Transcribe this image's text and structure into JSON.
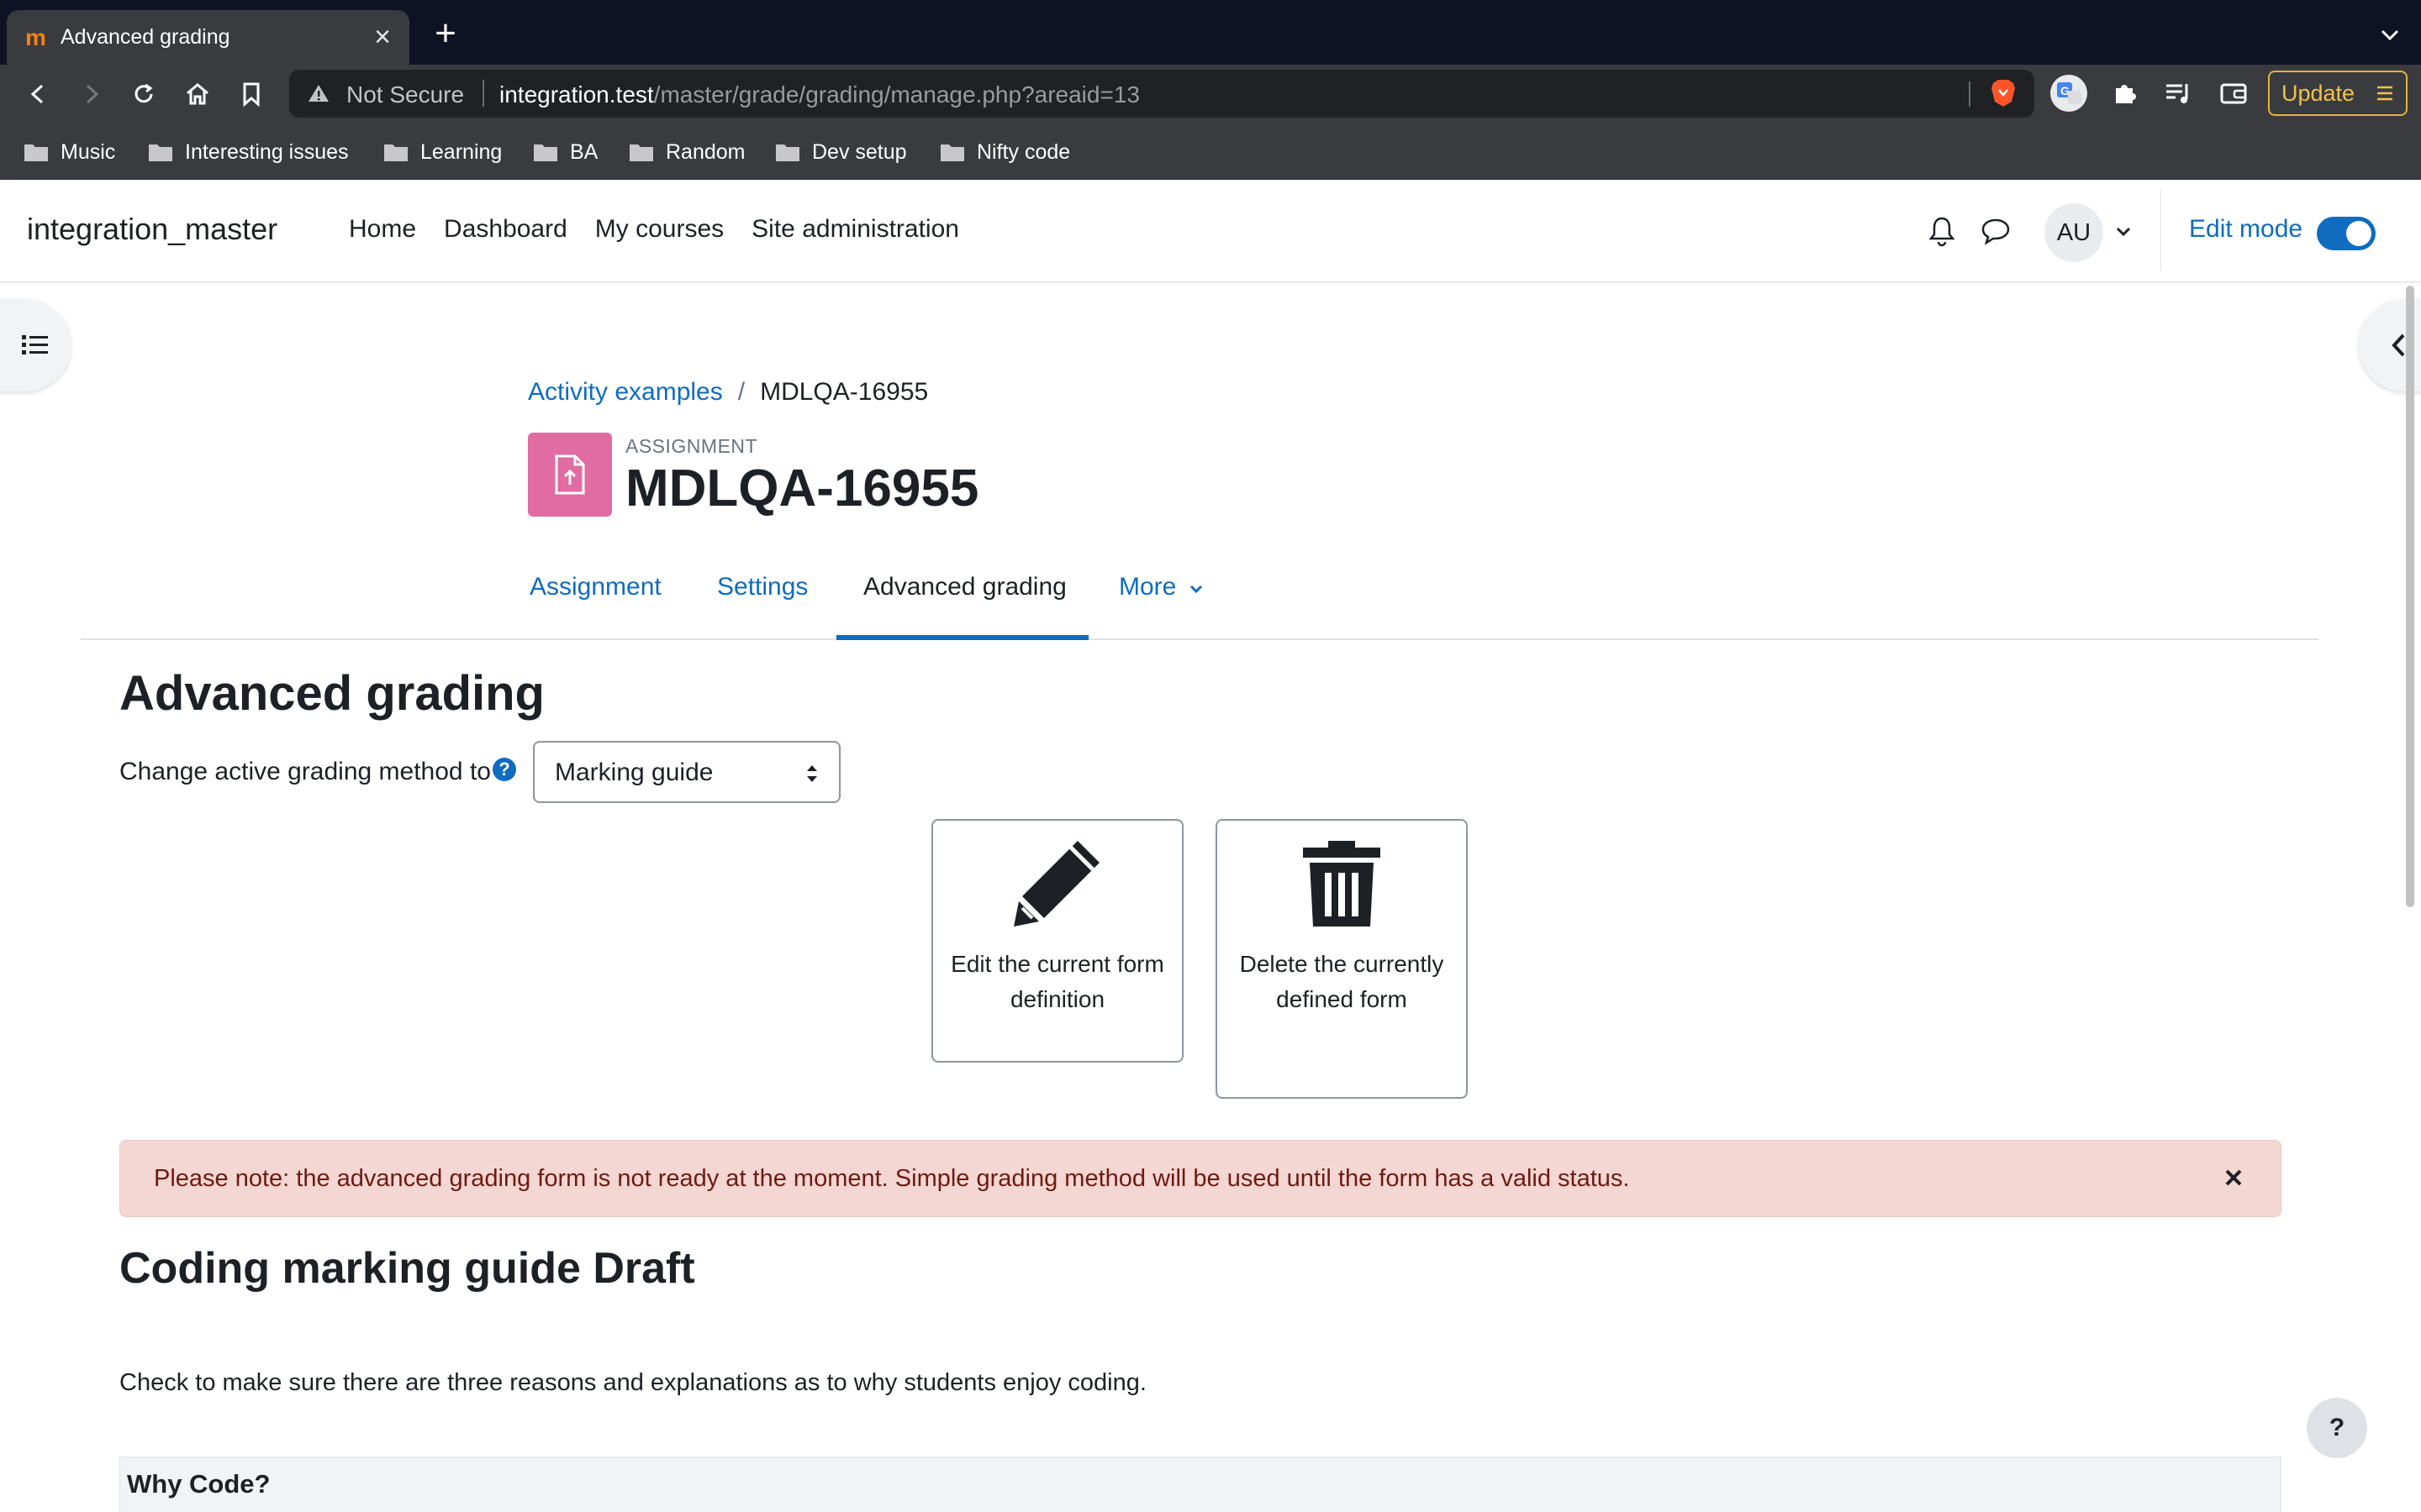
{
  "browser": {
    "tab_title": "Advanced grading",
    "not_secure": "Not Secure",
    "url_host": "integration.test",
    "url_path": "/master/grade/grading/manage.php?areaid=13",
    "update_label": "Update",
    "bookmarks": [
      "Music",
      "Interesting issues",
      "Learning",
      "BA",
      "Random",
      "Dev setup",
      "Nifty code"
    ]
  },
  "navbar": {
    "brand": "integration_master",
    "links": [
      "Home",
      "Dashboard",
      "My courses",
      "Site administration"
    ],
    "avatar_initials": "AU",
    "edit_mode_label": "Edit mode",
    "edit_mode_on": true
  },
  "header": {
    "breadcrumb": [
      "Activity examples",
      "MDLQA-16955"
    ],
    "activity_type": "ASSIGNMENT",
    "activity_title": "MDLQA-16955"
  },
  "secondary_nav": {
    "tabs": [
      "Assignment",
      "Settings",
      "Advanced grading",
      "More"
    ],
    "active_tab": "Advanced grading"
  },
  "main": {
    "heading": "Advanced grading",
    "method_label": "Change active grading method to",
    "method_selected": "Marking guide",
    "actions": [
      {
        "label": "Edit the current form definition",
        "icon": "pencil-icon"
      },
      {
        "label": "Delete the currently defined form",
        "icon": "trash-icon"
      }
    ],
    "alert": "Please note: the advanced grading form is not ready at the moment. Simple grading method will be used until the form has a valid status.",
    "guide_heading": "Coding marking guide Draft",
    "guide_description": "Check to make sure there are three reasons and explanations as to why students enjoy coding.",
    "criterion_name": "Why Code?"
  },
  "colors": {
    "brand_blue": "#0f6cbf",
    "assignment_pink": "#e06ca1",
    "alert_bg": "#f4d6d2",
    "alert_text": "#6e1a12"
  }
}
